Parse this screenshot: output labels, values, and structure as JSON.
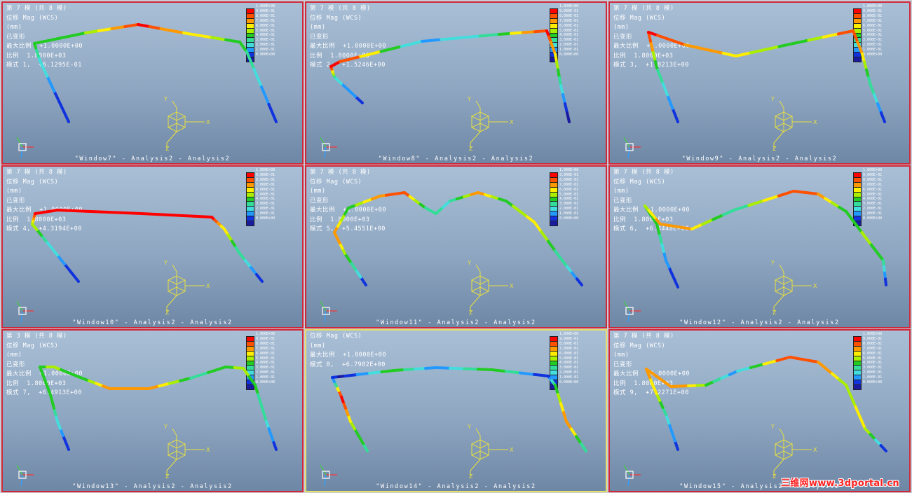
{
  "legend": {
    "ticks": [
      "1.000E+00",
      "9.000E-01",
      "8.000E-01",
      "7.000E-01",
      "6.000E-01",
      "5.000E-01",
      "4.000E-01",
      "3.000E-01",
      "2.000E-01",
      "1.000E-01",
      "0.000E+00"
    ],
    "colors": [
      "#ff0000",
      "#ff5000",
      "#ff9900",
      "#ffee00",
      "#aaee00",
      "#22cc22",
      "#33dd99",
      "#44dddd",
      "#2299ff",
      "#1133dd",
      "#1a1aa0"
    ]
  },
  "axes": {
    "x": "X",
    "y": "Y",
    "z": "Z"
  },
  "panels": [
    {
      "id": "w7",
      "lines": [
        "第 7 模 (共 8 模)",
        "位移 Mag (WCS)",
        "(mm)",
        "已变形",
        "最大比例  +1.0000E+00",
        "比例  1.8000E+03",
        "模式 1,  +6.1295E-01"
      ],
      "footer": "\"Window7\" - Analysis2 - Analysis2"
    },
    {
      "id": "w8",
      "lines": [
        "第 7 模 (共 8 模)",
        "位移 Mag (WCS)",
        "(mm)",
        "已变形",
        "最大比例  +1.0000E+00",
        "比例  1.8000E+03",
        "模式 2,  +1.5246E+00"
      ],
      "footer": "\"Window8\" - Analysis2 - Analysis2"
    },
    {
      "id": "w9",
      "lines": [
        "第 7 模 (共 8 模)",
        "位移 Mag (WCS)",
        "(mm)",
        "已变形",
        "最大比例  +1.0000E+00",
        "比例  1.8000E+03",
        "模式 3,  +1.8213E+00"
      ],
      "footer": "\"Window9\" - Analysis2 - Analysis2"
    },
    {
      "id": "w10",
      "lines": [
        "第 7 模 (共 8 模)",
        "位移 Mag (WCS)",
        "(mm)",
        "已变形",
        "最大比例  +1.0000E+00",
        "比例  1.8000E+03",
        "模式 4,  +4.3194E+00"
      ],
      "footer": "\"Window10\" - Analysis2 - Analysis2"
    },
    {
      "id": "w11",
      "lines": [
        "第 7 模 (共 8 模)",
        "位移 Mag (WCS)",
        "(mm)",
        "已变形",
        "最大比例  +1.0000E+00",
        "比例  1.8000E+03",
        "模式 5,  +5.4551E+00"
      ],
      "footer": "\"Window11\" - Analysis2 - Analysis2"
    },
    {
      "id": "w12",
      "lines": [
        "第 7 模 (共 8 模)",
        "位移 Mag (WCS)",
        "(mm)",
        "已变形",
        "最大比例  +1.0000E+00",
        "比例  1.8000E+03",
        "模式 6,  +6.4448E+00"
      ],
      "footer": "\"Window12\" - Analysis2 - Analysis2"
    },
    {
      "id": "w13",
      "lines": [
        "第 3 模 (共 8 模)",
        "位移 Mag (WCS)",
        "(mm)",
        "已变形",
        "最大比例  +1.0000E+00",
        "比例  1.8000E+03",
        "模式 7,  +6.4913E+00"
      ],
      "footer": "\"Window13\" - Analysis2 - Analysis2"
    },
    {
      "id": "w14",
      "lines": [
        "位移 Mag (WCS)",
        "(mm)",
        "最大比例  +1.0000E+00",
        "模式 8,  +6.7982E+00"
      ],
      "footer": "\"Window14\" - Analysis2 - Analysis2"
    },
    {
      "id": "w15",
      "lines": [
        "第 7 模 (共 8 模)",
        "位移 Mag (WCS)",
        "(mm)",
        "已变形",
        "最大比例  +1.0000E+00",
        "比例  1.8000E+03",
        "模式 9,  +7.2271E+00"
      ],
      "footer": "\"Window15\" - Analysis2 - Analysis2"
    }
  ],
  "watermark": "三维网www.3dportal.cn"
}
